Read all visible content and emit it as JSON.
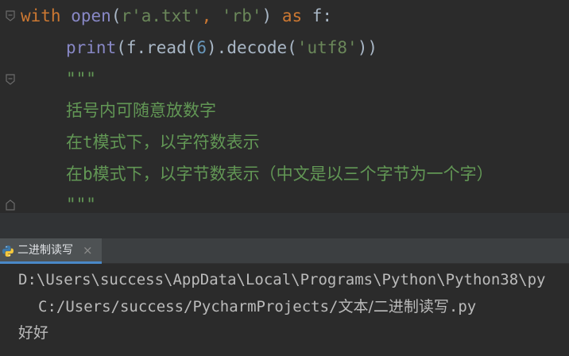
{
  "editor": {
    "line1": {
      "kw_with": "with",
      "fn_open": "open",
      "p_open": "(",
      "str_path": "r'a.txt'",
      "comma": ", ",
      "str_mode": "'rb'",
      "p_close": ")",
      "kw_as": "as",
      "var_f": "f:"
    },
    "line2": {
      "fn_print": "print",
      "mid1": "(f.read(",
      "num": "6",
      "mid2": ").decode(",
      "str_enc": "'utf8'",
      "end": "))"
    },
    "doc_open": "\"\"\"",
    "doc_line1": "括号内可随意放数字",
    "doc_line2_a": "在",
    "doc_line2_b": "t",
    "doc_line2_c": "模式下，以字符数表示",
    "doc_line3_a": "在",
    "doc_line3_b": "b",
    "doc_line3_c": "模式下，以字节数表示（中文是以三个字节为一个字）",
    "doc_close": "\"\"\""
  },
  "run_panel": {
    "tab_label": "二进制读写",
    "close_glyph": "×"
  },
  "console": {
    "cmd_line1": "D:\\Users\\success\\AppData\\Local\\Programs\\Python\\Python38\\py",
    "cmd_line2_path": "C:/Users/success/PycharmProjects/",
    "cmd_line2_cjk": "文本/二进制读写",
    "cmd_line2_ext": ".py",
    "output": "好好"
  },
  "colors": {
    "background": "#2b2b2b",
    "keyword": "#cc7832",
    "builtin": "#8888c6",
    "string": "#6a8759",
    "number": "#6897bb",
    "docstring": "#629755",
    "tab_accent": "#4a88c7"
  },
  "icons": [
    "fold-collapse-icon",
    "fold-end-icon",
    "python-icon",
    "close-icon"
  ]
}
